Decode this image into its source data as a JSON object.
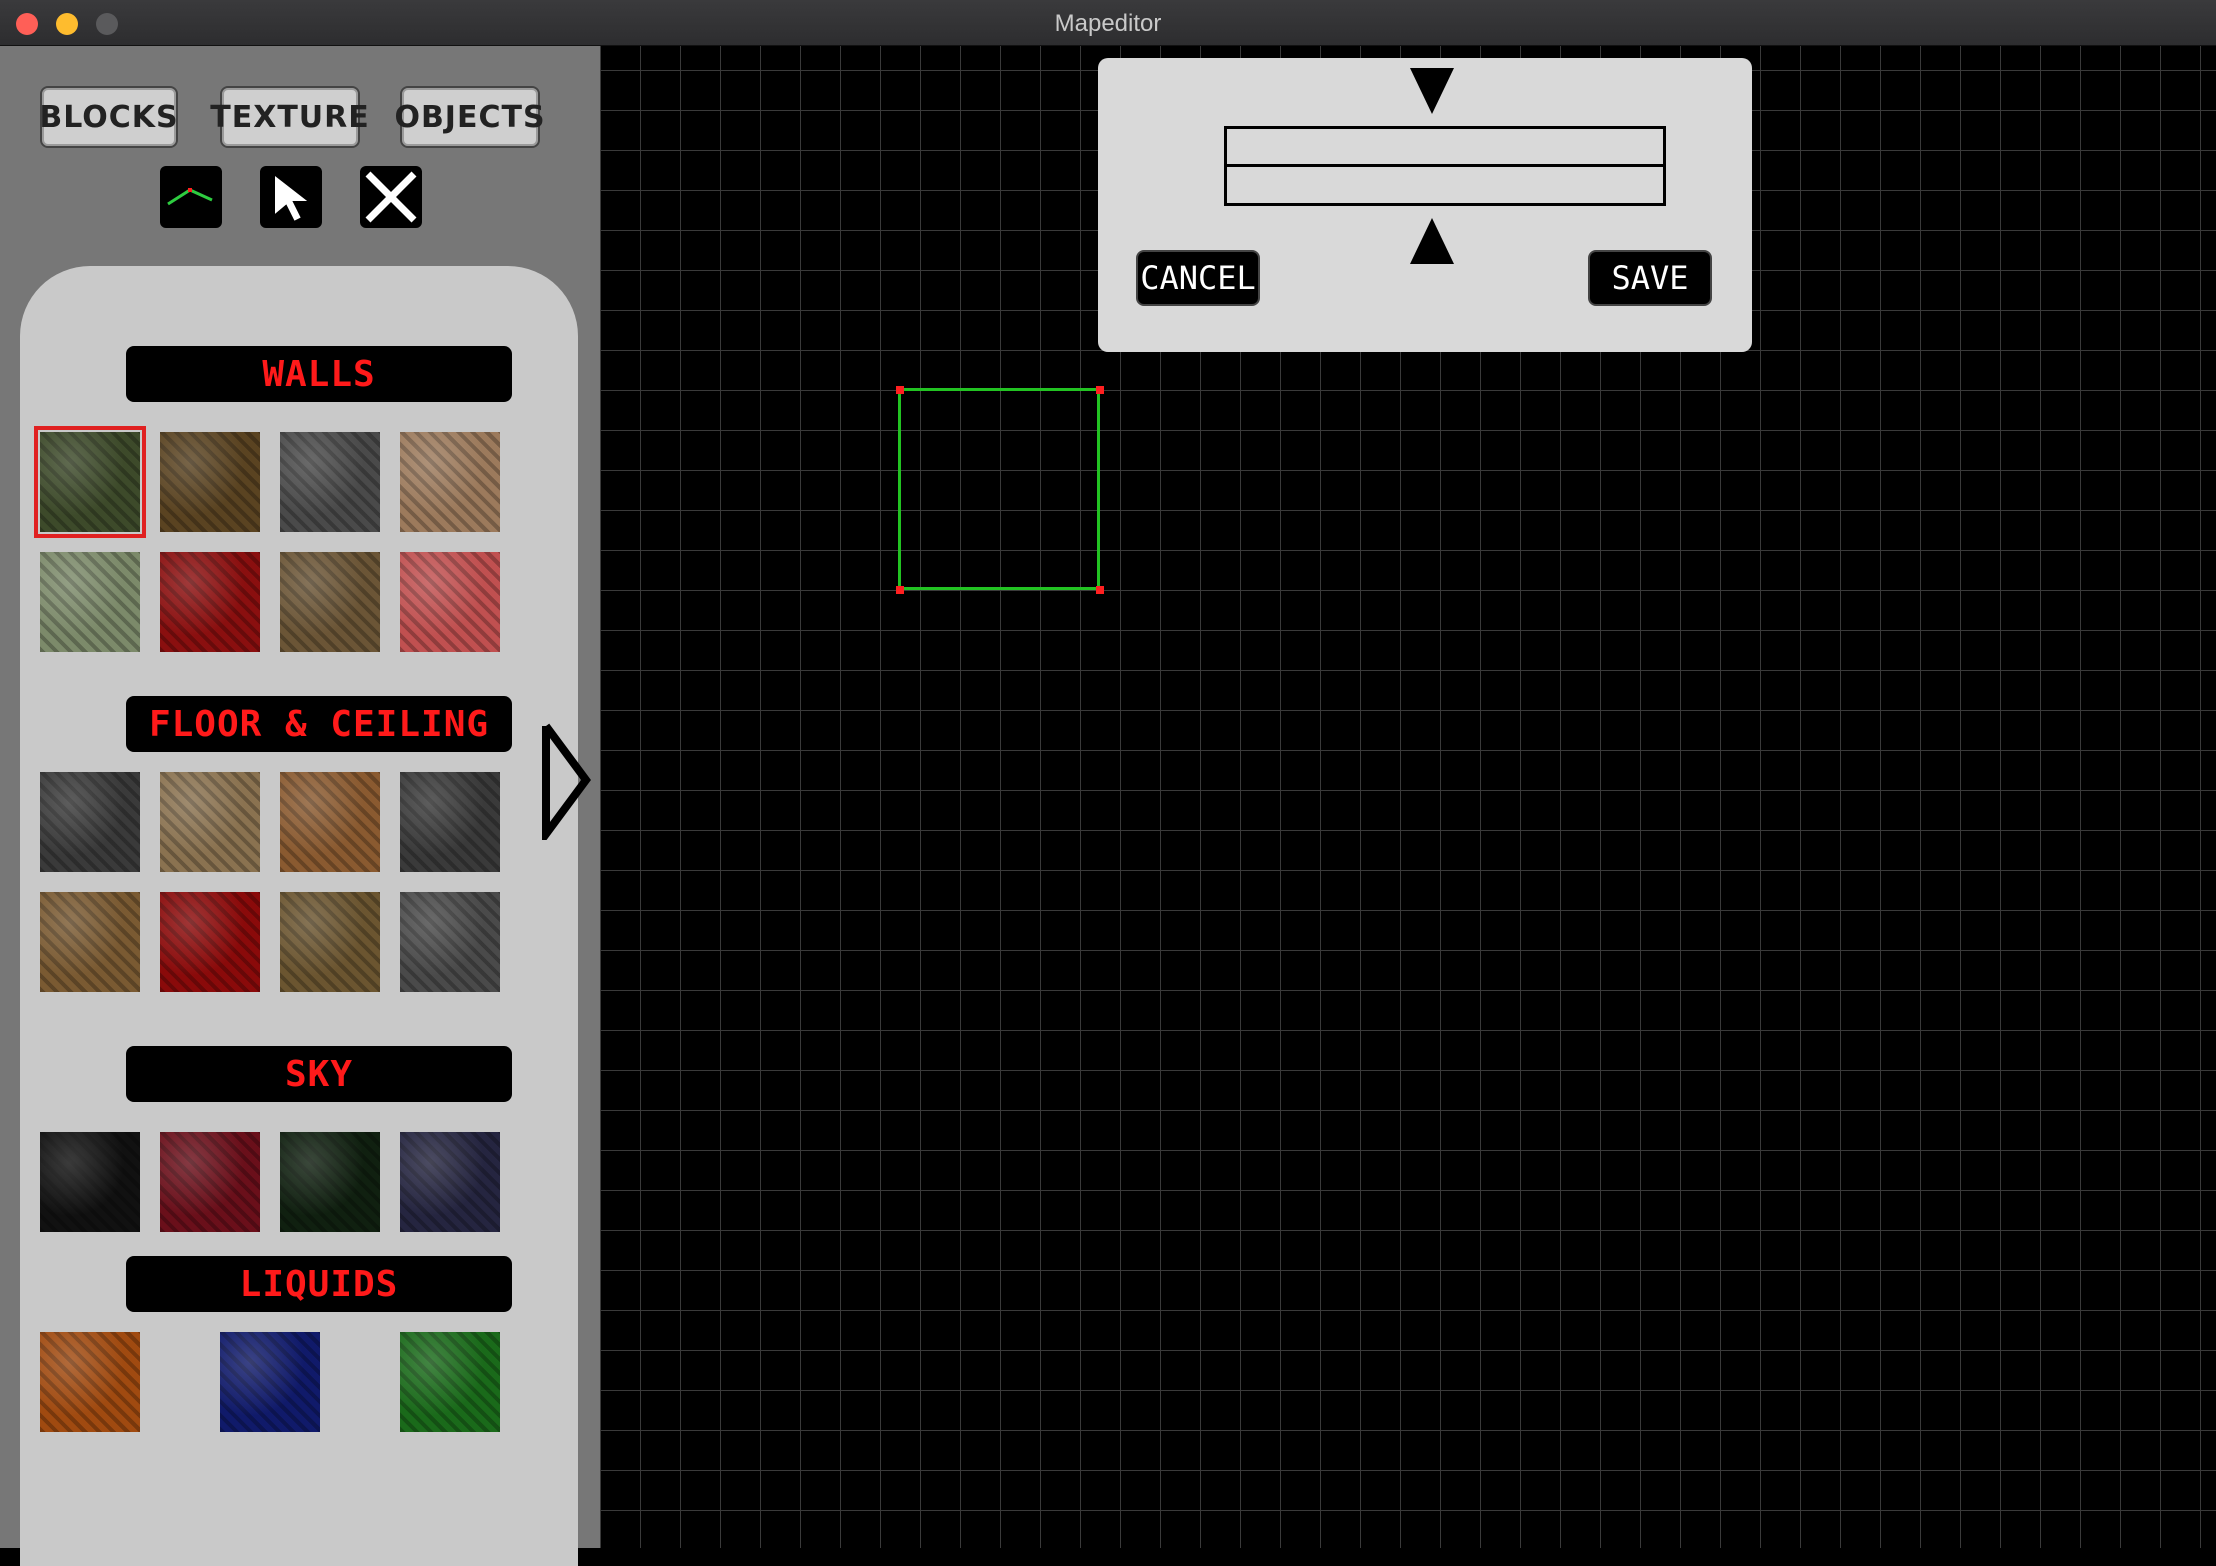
{
  "window": {
    "title": "Mapeditor"
  },
  "tabs": {
    "blocks": "BLOCKS",
    "texture": "TEXTURE",
    "objects": "OBJECTS"
  },
  "tools": [
    "draw-line-icon",
    "pointer-icon",
    "close-icon"
  ],
  "sections": {
    "walls": "WALLS",
    "floor": "FLOOR & CEILING",
    "sky": "SKY",
    "liquids": "LIQUIDS"
  },
  "dialog": {
    "cancel": "CANCEL",
    "save": "SAVE"
  },
  "textures": {
    "walls": [
      "#3d4a2a",
      "#5a4321",
      "#4a4a4a",
      "#9c7a5c",
      "#7c8a6a",
      "#8a0f0f",
      "#6b5536",
      "#c05050"
    ],
    "floor": [
      "#3a3a3a",
      "#8a7250",
      "#8a5a30",
      "#3a3a3a",
      "#7a5a32",
      "#8a0a0a",
      "#6b5530",
      "#4a4a4a"
    ],
    "sky": [
      "#111111",
      "#6a0f1a",
      "#102010",
      "#252540"
    ],
    "liquids": [
      "#a04a10",
      "#101a6a",
      "#1a6a1a"
    ]
  }
}
